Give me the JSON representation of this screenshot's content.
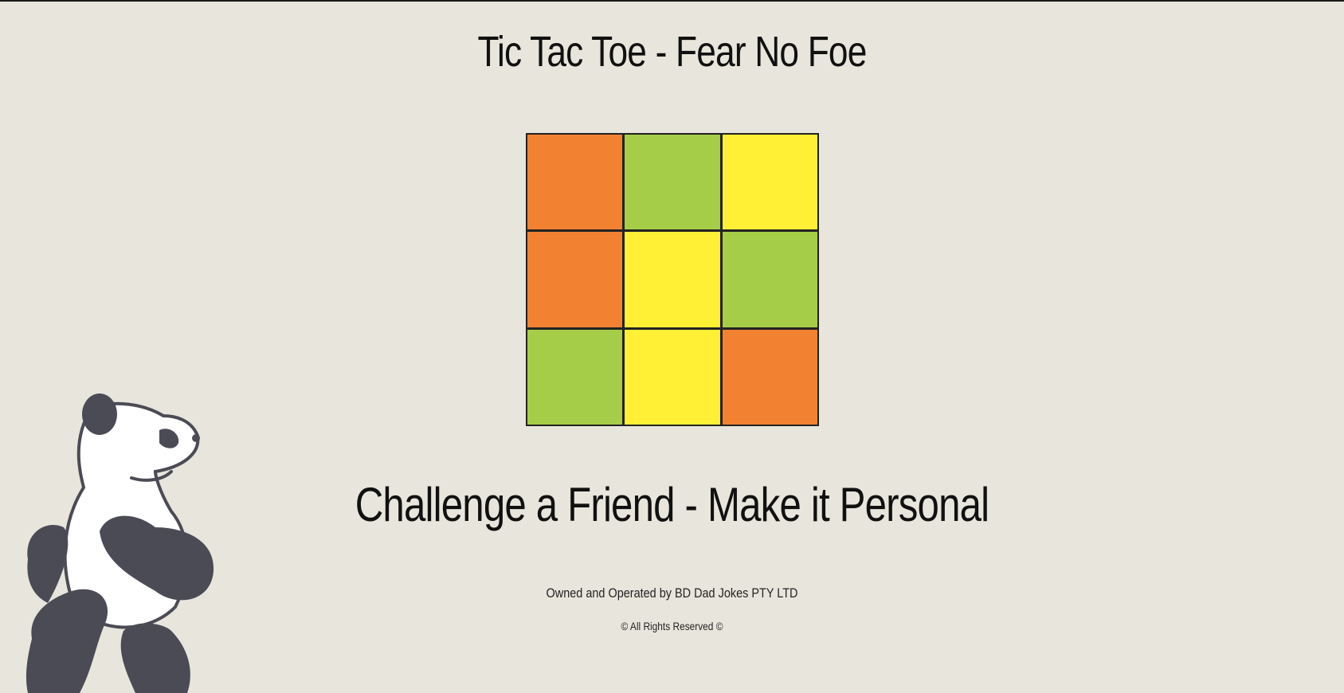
{
  "header": {
    "title": "Tic Tac Toe - Fear No Foe"
  },
  "board": {
    "colors": {
      "orange": "#f28232",
      "green": "#a6cd47",
      "yellow": "#fff036"
    },
    "cells": [
      {
        "color": "#f28232"
      },
      {
        "color": "#a6cd47"
      },
      {
        "color": "#fff036"
      },
      {
        "color": "#f28232"
      },
      {
        "color": "#fff036"
      },
      {
        "color": "#a6cd47"
      },
      {
        "color": "#a6cd47"
      },
      {
        "color": "#fff036"
      },
      {
        "color": "#f28232"
      }
    ]
  },
  "main": {
    "subtitle": "Challenge a Friend - Make it Personal"
  },
  "footer": {
    "owner": "Owned and Operated by BD Dad Jokes PTY LTD",
    "rights": "© All Rights Reserved ©"
  },
  "mascot": {
    "icon": "panda-icon",
    "body_color": "#ffffff",
    "patch_color": "#4a4b55"
  }
}
